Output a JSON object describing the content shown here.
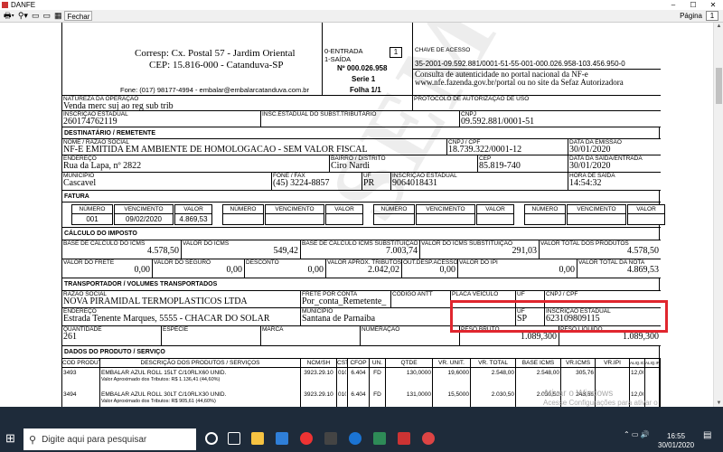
{
  "window": {
    "title": "DANFE",
    "min": "–",
    "max": "☐",
    "close": "✕"
  },
  "toolbar": {
    "close_label": "Fechar",
    "page_label": "Página",
    "page_num": "1",
    "page_total": "1"
  },
  "header": {
    "addr1": "Corresp: Cx. Postal 57 - Jardim Oriental",
    "addr2": "CEP: 15.816-000 - Catanduva-SP",
    "phone": "Fone: (017) 98177-4994 - embalar@embalarcatanduva.com.br",
    "entrada": "0-ENTRADA",
    "saida": "1-SAÍDA",
    "tipo": "1",
    "numero": "Nº 000.026.958",
    "serie": "Serie 1",
    "folha": "Folha 1/1",
    "chave_label": "CHAVE DE ACESSO",
    "chave": "35-2001-09.592.881/0001-51-55-001-000.026.958-103.456.950-0",
    "consulta1": "Consulta de autenticidade no portal nacional da NF-e",
    "consulta2": "www.nfe.fazenda.gov.br/portal ou no site da Sefaz Autorizadora"
  },
  "natureza": {
    "label": "NATUREZA DA OPERAÇÃO",
    "value": "Venda merc suj ao reg sub trib",
    "protocolo_label": "PROTOCOLO DE AUTORIZAÇÃO DE USO"
  },
  "inscricao": {
    "ie_label": "INSCRIÇÃO ESTADUAL",
    "ie": "260174762119",
    "ie_st_label": "INSC.ESTADUAL DO SUBST.TRIBUTÁRIO",
    "cnpj_label": "CNPJ",
    "cnpj": "09.592.881/0001-51"
  },
  "dest": {
    "section": "DESTINATÁRIO / REMETENTE",
    "nome_label": "NOME / RAZÃO SOCIAL",
    "nome": "NF-E EMITIDA EM AMBIENTE DE HOMOLOGACAO - SEM VALOR FISCAL",
    "cnpj_label": "CNPJ / CPF",
    "cnpj": "18.739.322/0001-12",
    "emissao_label": "DATA DA EMISSÃO",
    "emissao": "30/01/2020",
    "end_label": "ENDEREÇO",
    "end": "Rua da Lapa, nº 2822",
    "bairro_label": "BAIRRO / DISTRITO",
    "bairro": "Ciro Nardi",
    "cep_label": "CEP",
    "cep": "85.819-740",
    "saida_label": "DATA DA SAÍDA/ENTRADA",
    "saida": "30/01/2020",
    "mun_label": "MUNICÍPIO",
    "mun": "Cascavel",
    "fone_label": "FONE / FAX",
    "fone": "(45) 3224-8857",
    "uf_label": "UF",
    "uf": "PR",
    "ie_label": "INSCRIÇÃO ESTADUAL",
    "ie": "9064018431",
    "hora_label": "HORA DE SAÍDA",
    "hora": "14:54:32"
  },
  "fatura": {
    "section": "FATURA",
    "h_numero": "NÚMERO",
    "h_venc": "VENCIMENTO",
    "h_valor": "VALOR",
    "numero": "001",
    "venc": "09/02/2020",
    "valor": "4.869,53"
  },
  "imposto": {
    "section": "CÁLCULO DO IMPOSTO",
    "bc_label": "BASE DE CÁLCULO DO ICMS",
    "bc": "4.578,50",
    "icms_label": "VALOR DO ICMS",
    "icms": "549,42",
    "bcst_label": "BASE DE CÁLCULO ICMS SUBSTITUIÇÃO",
    "bcst": "7.003,74",
    "icmsst_label": "VALOR DO ICMS SUBSTITUIÇÃO",
    "icmsst": "291,03",
    "vprod_label": "VALOR TOTAL DOS PRODUTOS",
    "vprod": "4.578,50",
    "frete_label": "VALOR DO FRETE",
    "frete": "0,00",
    "seguro_label": "VALOR DO SEGURO",
    "seguro": "0,00",
    "desc_label": "DESCONTO",
    "desc": "0,00",
    "trib_label": "VALOR APROX. TRIBUTOS",
    "trib": "2.042,02",
    "outras_label": "OUT.DESP.ACESSÓRIAS",
    "outras": "0,00",
    "ipi_label": "VALOR DO IPI",
    "ipi": "0,00",
    "vnota_label": "VALOR TOTAL DA NOTA",
    "vnota": "4.869,53"
  },
  "transp": {
    "section": "TRANSPORTADOR / VOLUMES TRANSPORTADOS",
    "razao_label": "RAZÃO SOCIAL",
    "razao": "NOVA PIRAMIDAL TERMOPLASTICOS LTDA",
    "frete_label": "FRETE POR CONTA",
    "frete": "Por_conta_Remetente_",
    "antt_label": "CÓDIGO ANTT",
    "placa_label": "PLACA VEÍCULO",
    "uf_label": "UF",
    "cnpj_label": "CNPJ / CPF",
    "end_label": "ENDEREÇO",
    "end": "Estrada Tenente Marques, 5555 - CHACAR DO SOLAR",
    "mun_label": "MUNICÍPIO",
    "mun": "Santana de Parnaiba",
    "uf2": "SP",
    "ie_label": "INSCRIÇÃO ESTADUAL",
    "ie": "623109809115",
    "qtd_label": "QUANTIDADE",
    "qtd": "261",
    "esp_label": "ESPÉCIE",
    "marca_label": "MARCA",
    "num_label": "NUMERAÇÃO",
    "pb_label": "PESO BRUTO",
    "pb": "1.089,300",
    "pl_label": "PESO LÍQUIDO",
    "pl": "1.089,300"
  },
  "produtos": {
    "section": "DADOS DO PRODUTO / SERVIÇO",
    "headers": [
      "COD PRODUT",
      "DESCRIÇÃO DOS PRODUTOS / SERVIÇOS",
      "NCM/SH",
      "CST",
      "CFOP",
      "UN.",
      "QTDE",
      "VR. UNIT.",
      "VR. TOTAL",
      "BASE ICMS",
      "VR.ICMS",
      "VR.IPI",
      "ALIQ.ICMS",
      "ALIQ.IPI"
    ],
    "rows": [
      {
        "cod": "3493",
        "desc": "EMBALAR AZUL ROLL 15LT C/10RLX60 UNID.",
        "sub": "Valor Aproximado dos Tributos: R$ 1.136,41 (44,60%)",
        "ncm": "3923.29.10",
        "cst": "010",
        "cfop": "6.404",
        "un": "FD",
        "qtde": "130,0000",
        "vunit": "19,6000",
        "vtotal": "2.548,00",
        "bc": "2.548,00",
        "vicms": "305,76",
        "vipi": "",
        "aliq": "12,00"
      },
      {
        "cod": "3494",
        "desc": "EMBALAR AZUL ROLL 30LT C/10RLX30 UNID.",
        "sub": "Valor Aproximado dos Tributos: R$ 905,61 (44,60%)",
        "ncm": "3923.29.10",
        "cst": "010",
        "cfop": "6.404",
        "un": "FD",
        "qtde": "131,0000",
        "vunit": "15,5000",
        "vtotal": "2.030,50",
        "bc": "2.030,50",
        "vicms": "243,66",
        "vipi": "",
        "aliq": "12,00"
      }
    ]
  },
  "watermark": "SEM VALOR FISCAL",
  "windows_wm": {
    "line1": "Ativar o Windows",
    "line2": "Acesse Configurações para ativar o"
  },
  "taskbar": {
    "search_placeholder": "Digite aqui para pesquisar",
    "time": "16:55",
    "date": "30/01/2020"
  },
  "colors": {
    "highlight": "#e0262e",
    "taskbar": "#1e2b3a"
  }
}
